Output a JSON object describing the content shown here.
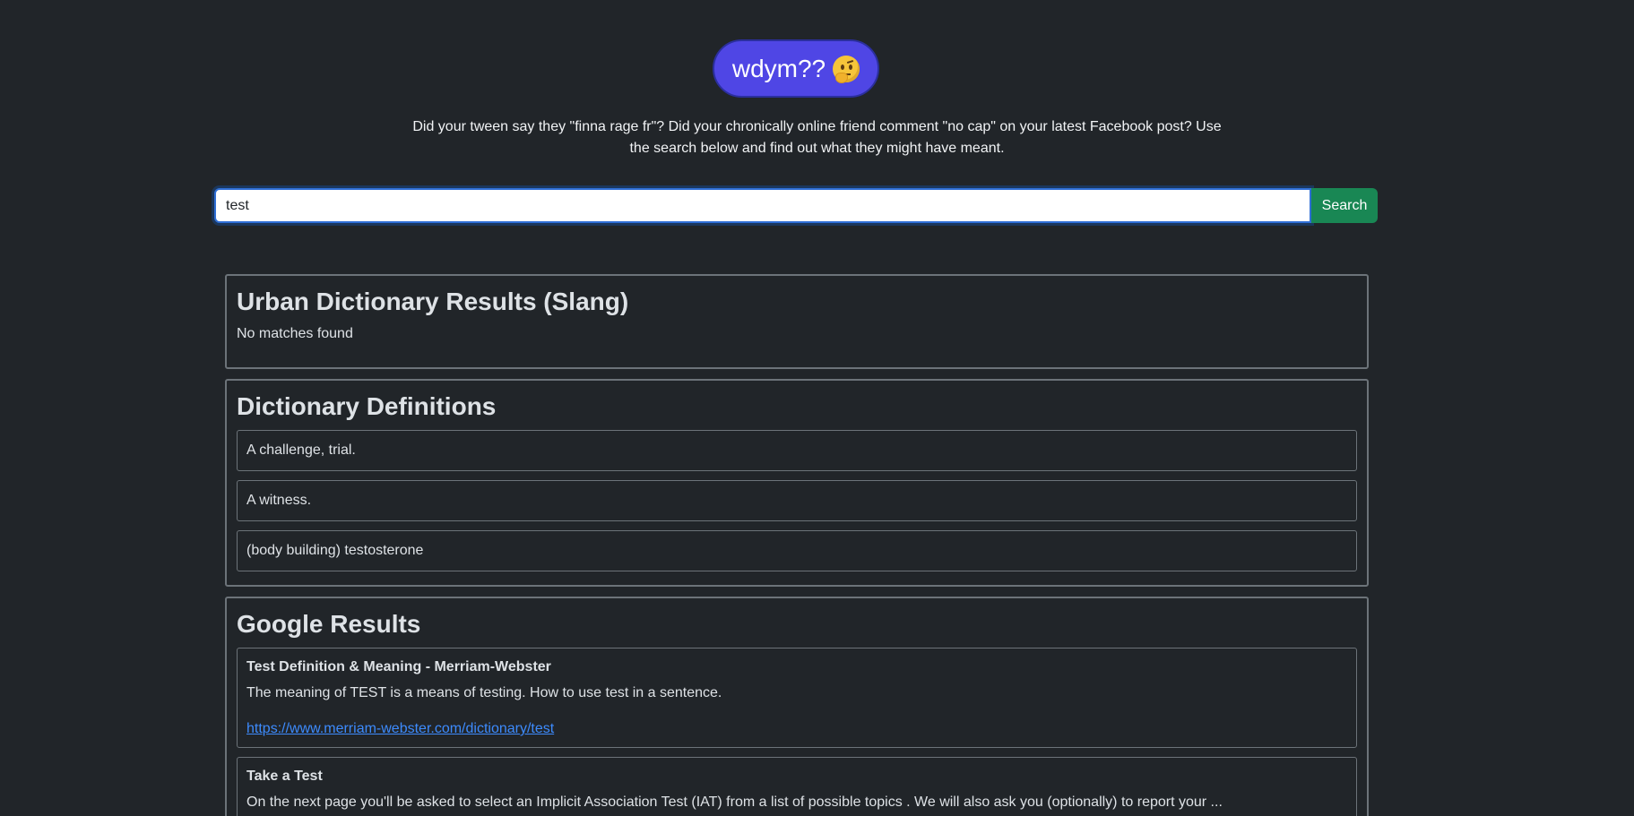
{
  "logo": {
    "text": "wdym??",
    "emoji_icon": "thinking-face-icon",
    "bg_color": "#4f46e5"
  },
  "tagline": "Did your tween say they \"finna rage fr\"? Did your chronically online friend comment \"no cap\" on your latest Facebook post? Use the search below and find out what they might have meant.",
  "search": {
    "value": "test",
    "button_label": "Search",
    "button_color": "#198754"
  },
  "urban": {
    "title": "Urban Dictionary Results (Slang)",
    "empty_text": "No matches found"
  },
  "dictionary": {
    "title": "Dictionary Definitions",
    "definitions": [
      "A challenge, trial.",
      "A witness.",
      "(body building) testosterone"
    ]
  },
  "google": {
    "title": "Google Results",
    "results": [
      {
        "title": "Test Definition & Meaning - Merriam-Webster",
        "snippet": "The meaning of TEST is a means of testing. How to use test in a sentence.",
        "link": "https://www.merriam-webster.com/dictionary/test"
      },
      {
        "title": "Take a Test",
        "snippet": "On the next page you'll be asked to select an Implicit Association Test (IAT) from a list of possible topics . We will also ask you (optionally) to report your ..."
      }
    ]
  }
}
